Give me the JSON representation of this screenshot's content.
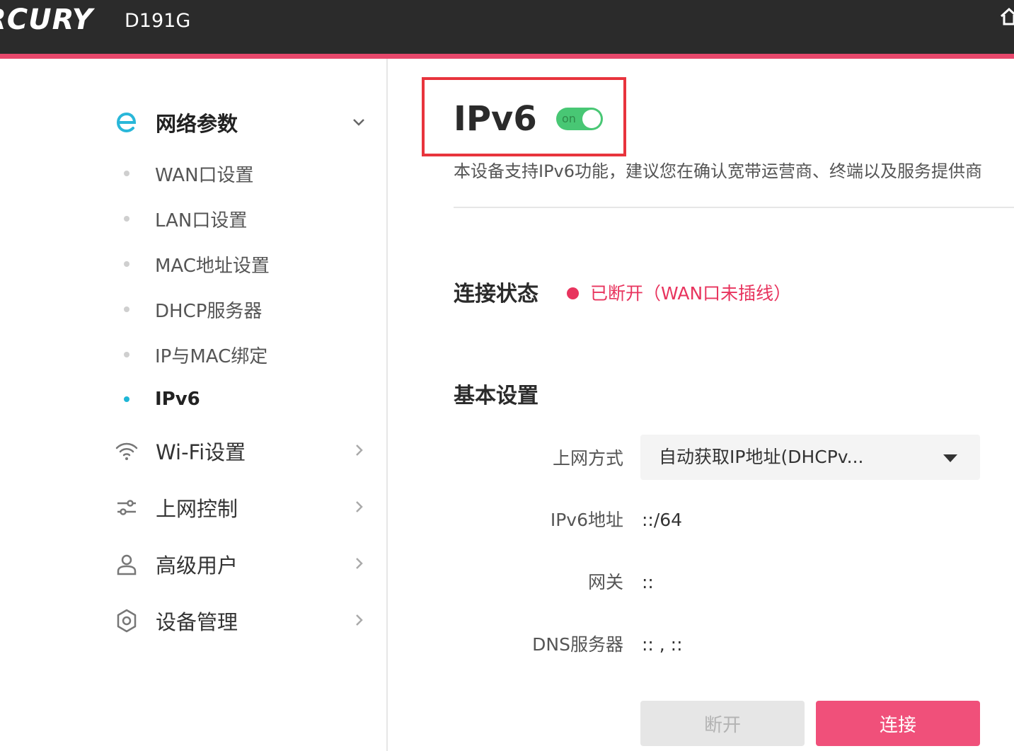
{
  "header": {
    "brand": "RCURY",
    "model": "D191G"
  },
  "sidebar": {
    "groups": [
      {
        "label": "网络参数",
        "icon": "ethernet-e-icon"
      },
      {
        "label": "Wi-Fi设置",
        "icon": "wifi-icon"
      },
      {
        "label": "上网控制",
        "icon": "sliders-icon"
      },
      {
        "label": "高级用户",
        "icon": "user-icon"
      },
      {
        "label": "设备管理",
        "icon": "gear-icon"
      }
    ],
    "sub_items": [
      {
        "label": "WAN口设置"
      },
      {
        "label": "LAN口设置"
      },
      {
        "label": "MAC地址设置"
      },
      {
        "label": "DHCP服务器"
      },
      {
        "label": "IP与MAC绑定"
      },
      {
        "label": "IPv6"
      }
    ]
  },
  "main": {
    "title": "IPv6",
    "toggle_label": "on",
    "description": "本设备支持IPv6功能，建议您在确认宽带运营商、终端以及服务提供商",
    "connection": {
      "label": "连接状态",
      "status": "已断开（WAN口未插线）"
    },
    "basic": {
      "title": "基本设置",
      "mode_label": "上网方式",
      "mode_value": "自动获取IP地址(DHCPv...",
      "ipv6_label": "IPv6地址",
      "ipv6_value": "::/64",
      "gateway_label": "网关",
      "gateway_value": "::",
      "dns_label": "DNS服务器",
      "dns_value": ":: , ::"
    },
    "buttons": {
      "disconnect": "断开",
      "connect": "连接"
    }
  },
  "colors": {
    "accent": "#e8476b",
    "status_error": "#e8345e",
    "toggle_on": "#48c774",
    "active_dot": "#1fb6d6",
    "highlight": "#e8343d"
  }
}
